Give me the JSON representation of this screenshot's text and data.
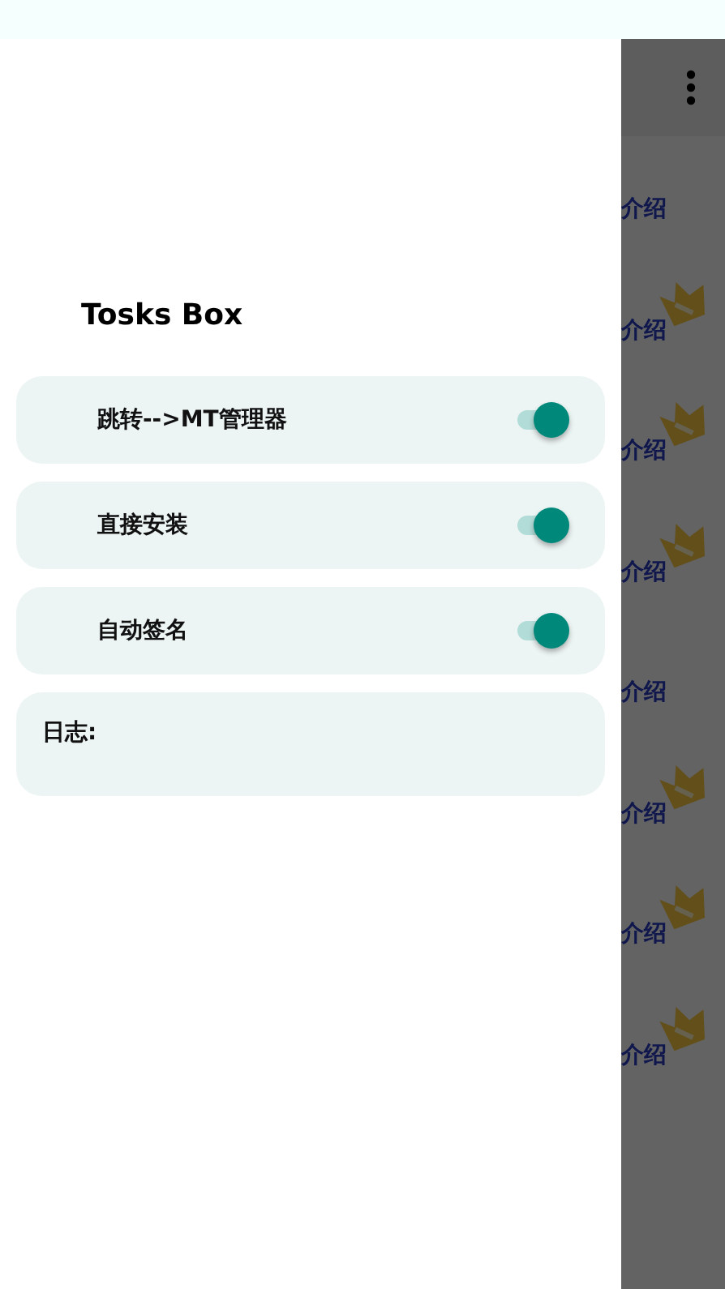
{
  "drawer": {
    "title": "Tosks Box",
    "toggles": [
      {
        "label": "跳转-->MT管理器",
        "on": true
      },
      {
        "label": "直接安装",
        "on": true
      },
      {
        "label": "自动签名",
        "on": true
      }
    ],
    "log": {
      "label": "日志:"
    }
  },
  "background": {
    "rows": [
      {
        "label": "介绍",
        "crown": false
      },
      {
        "label": "介绍",
        "crown": true
      },
      {
        "label": "介绍",
        "crown": true
      },
      {
        "label": "介绍",
        "crown": true
      },
      {
        "label": "介绍",
        "crown": false
      },
      {
        "label": "介绍",
        "crown": true
      },
      {
        "label": "介绍",
        "crown": true
      },
      {
        "label": "介绍",
        "crown": true
      }
    ]
  }
}
